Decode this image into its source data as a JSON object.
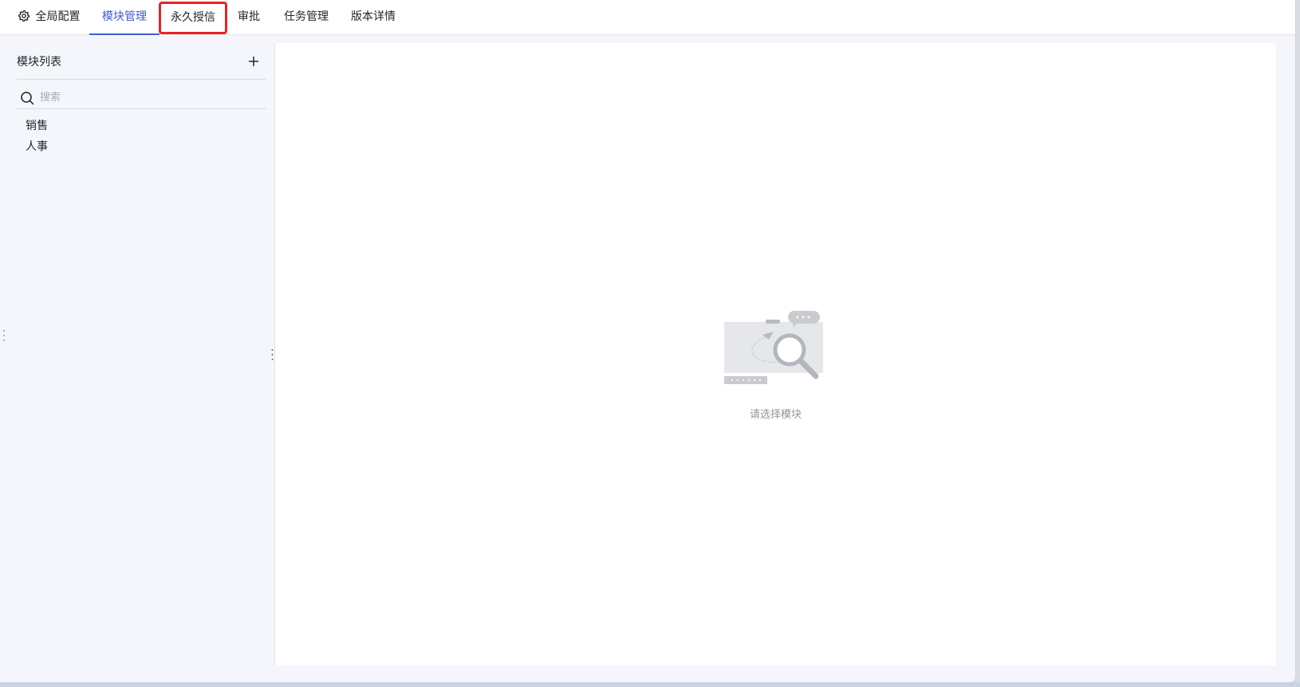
{
  "tabs": {
    "global_config": "全局配置",
    "module_mgmt": "模块管理",
    "permanent_auth": "永久授信",
    "approval": "审批",
    "task_mgmt": "任务管理",
    "version_details": "版本详情",
    "active": "模块管理",
    "highlighted": "永久授信"
  },
  "sidebar": {
    "title": "模块列表",
    "add_icon": "plus-icon",
    "search_placeholder": "搜索",
    "search_value": "",
    "items": [
      {
        "label": "销售"
      },
      {
        "label": "人事"
      }
    ]
  },
  "main": {
    "empty_text": "请选择模块",
    "empty_icon": "empty-search-illustration"
  },
  "colors": {
    "accent": "#3f5bd6",
    "highlight_border": "#ea2222",
    "panel_bg": "#f4f6fb"
  }
}
